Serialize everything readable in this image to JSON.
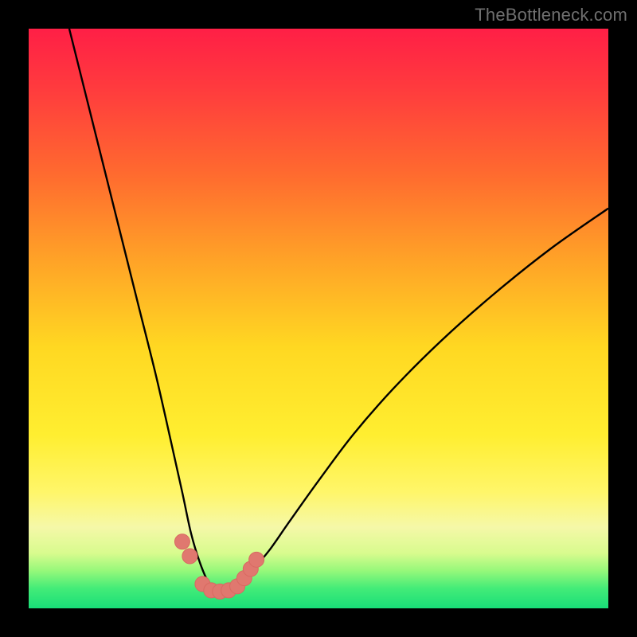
{
  "watermark": "TheBottleneck.com",
  "colors": {
    "bg": "#000000",
    "curve": "#000000",
    "marker_fill": "#e0786f",
    "marker_stroke": "#d86a62",
    "gradient_stops": [
      {
        "offset": 0.0,
        "color": "#ff1f46"
      },
      {
        "offset": 0.1,
        "color": "#ff3a3e"
      },
      {
        "offset": 0.25,
        "color": "#ff6a2f"
      },
      {
        "offset": 0.4,
        "color": "#ffa327"
      },
      {
        "offset": 0.55,
        "color": "#ffd822"
      },
      {
        "offset": 0.7,
        "color": "#ffee30"
      },
      {
        "offset": 0.8,
        "color": "#fff66a"
      },
      {
        "offset": 0.86,
        "color": "#f5f8a8"
      },
      {
        "offset": 0.905,
        "color": "#d8fb8e"
      },
      {
        "offset": 0.935,
        "color": "#96f87a"
      },
      {
        "offset": 0.965,
        "color": "#44ec78"
      },
      {
        "offset": 1.0,
        "color": "#18de78"
      }
    ]
  },
  "chart_data": {
    "type": "line",
    "title": "",
    "xlabel": "",
    "ylabel": "",
    "x_range": [
      0,
      100
    ],
    "y_range": [
      0,
      100
    ],
    "series": [
      {
        "name": "bottleneck-curve",
        "x": [
          7,
          10,
          13,
          16,
          19,
          22,
          24.5,
          26.5,
          28,
          29.5,
          31,
          32.5,
          34,
          36,
          38.5,
          41.5,
          45,
          50,
          56,
          63,
          71,
          80,
          90,
          100
        ],
        "y": [
          100,
          88,
          76,
          64,
          52,
          40,
          29,
          20,
          13,
          8,
          4.5,
          3,
          3,
          4,
          6.5,
          10,
          15,
          22,
          30,
          38,
          46,
          54,
          62,
          69
        ]
      }
    ],
    "markers": {
      "name": "highlight-points",
      "x": [
        26.5,
        27.8,
        30,
        31.5,
        33,
        34.5,
        36,
        37.2,
        38.3,
        39.3
      ],
      "y": [
        11.5,
        9,
        4.2,
        3.1,
        2.9,
        3.1,
        3.8,
        5.2,
        6.8,
        8.4
      ]
    }
  }
}
